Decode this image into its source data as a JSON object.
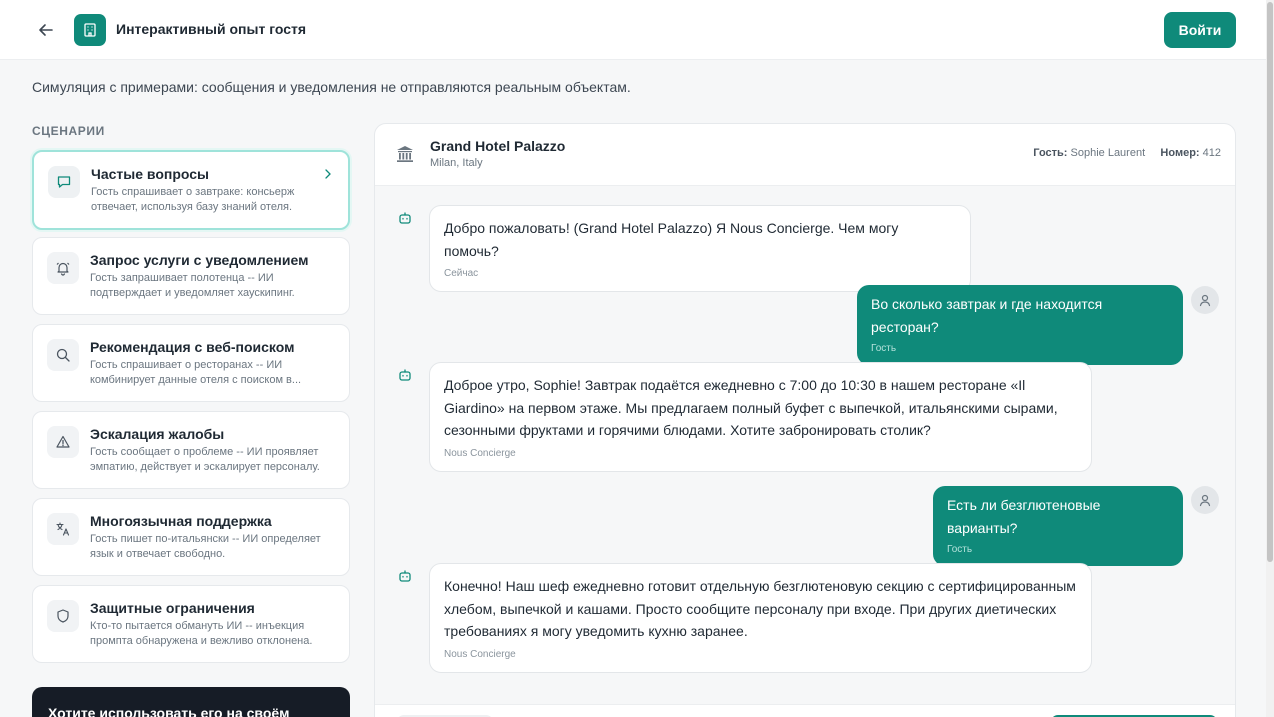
{
  "header": {
    "title": "Интерактивный опыт гостя",
    "login_label": "Войти"
  },
  "notice": "Симуляция с примерами: сообщения и уведомления не отправляются реальным объектам.",
  "scenarios": {
    "heading": "СЦЕНАРИИ",
    "items": [
      {
        "title": "Частые вопросы",
        "desc": "Гость спрашивает о завтраке: консьерж отвечает, используя базу знаний отеля.",
        "icon": "chat-bubble-icon",
        "active": true
      },
      {
        "title": "Запрос услуги с уведомлением",
        "desc": "Гость запрашивает полотенца -- ИИ подтверждает и уведомляет хаускипинг.",
        "icon": "bell-icon",
        "active": false
      },
      {
        "title": "Рекомендация с веб-поиском",
        "desc": "Гость спрашивает о ресторанах -- ИИ комбинирует данные отеля с поиском в...",
        "icon": "search-icon",
        "active": false
      },
      {
        "title": "Эскалация жалобы",
        "desc": "Гость сообщает о проблеме -- ИИ проявляет эмпатию, действует и эскалирует персоналу.",
        "icon": "warning-icon",
        "active": false
      },
      {
        "title": "Многоязычная поддержка",
        "desc": "Гость пишет по-итальянски -- ИИ определяет язык и отвечает свободно.",
        "icon": "translate-icon",
        "active": false
      },
      {
        "title": "Защитные ограничения",
        "desc": "Кто-то пытается обмануть ИИ -- инъекция промпта обнаружена и вежливо отклонена.",
        "icon": "shield-icon",
        "active": false
      }
    ]
  },
  "promo": {
    "text": "Хотите использовать его на своём"
  },
  "chat": {
    "hotel_name": "Grand Hotel Palazzo",
    "hotel_location": "Milan, Italy",
    "guest_label": "Гость:",
    "guest_name": "Sophie Laurent",
    "room_label": "Номер:",
    "room_number": "412",
    "messages": [
      {
        "role": "bot",
        "text": "Добро пожаловать! (Grand Hotel Palazzo) Я Nous Concierge. Чем могу помочь?",
        "meta": "Сейчас"
      },
      {
        "role": "user",
        "text": "Во сколько завтрак и где находится ресторан?",
        "meta": "Гость"
      },
      {
        "role": "bot",
        "text": "Доброе утро, Sophie! Завтрак подаётся ежедневно с 7:00 до 10:30 в нашем ресторане «Il Giardino» на первом этаже. Мы предлагаем полный буфет с выпечкой, итальянскими сырами, сезонными фруктами и горячими блюдами. Хотите забронировать столик?",
        "meta": "Nous Concierge"
      },
      {
        "role": "user",
        "text": "Есть ли безглютеновые варианты?",
        "meta": "Гость"
      },
      {
        "role": "bot",
        "text": "Конечно! Наш шеф ежедневно готовит отдельную безглютеновую секцию с сертифицированным хлебом, выпечкой и кашами. Просто сообщите персоналу при входе. При других диетических требованиях я могу уведомить кухню заранее.",
        "meta": "Nous Concierge"
      }
    ]
  },
  "colors": {
    "accent": "#0f8a7a",
    "active_border": "#9fe3da",
    "promo_bg": "#161c26"
  }
}
